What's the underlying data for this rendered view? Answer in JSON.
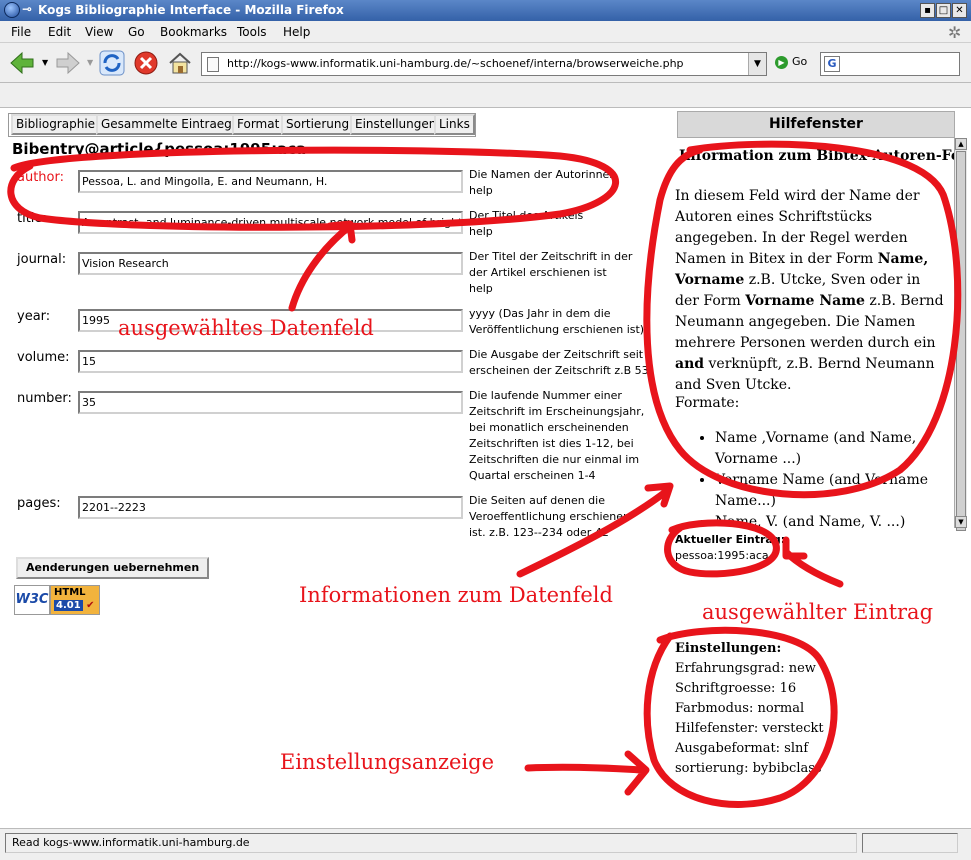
{
  "window": {
    "title": "Kogs Bibliographie Interface - Mozilla Firefox"
  },
  "menu": [
    "File",
    "Edit",
    "View",
    "Go",
    "Bookmarks",
    "Tools",
    "Help"
  ],
  "navbar": {
    "url": "http://kogs-www.informatik.uni-hamburg.de/~schoenef/interna/browserweiche.php",
    "go_label": "Go",
    "search_engine_letter": "G"
  },
  "tabs": [
    "Bibliographie",
    "Gesammelte Eintraege",
    "Format",
    "Sortierung",
    "Einstellungen",
    "Links"
  ],
  "entry_heading": "Bibentry@article{pessoa:1995:aca",
  "fields": [
    {
      "label": "author:",
      "value": "Pessoa, L. and Mingolla, E. and Neumann, H.",
      "help": "Die Namen der Autorinnen",
      "help2": "help"
    },
    {
      "label": "title:",
      "value": "A contrast- and luminance-driven multiscale network model of brightness",
      "help": "Der Titel des Artikels",
      "help2": "help"
    },
    {
      "label": "journal:",
      "value": "Vision Research",
      "help": "Der Titel der Zeitschrift in der der Artikel erschienen ist",
      "help2": "help"
    },
    {
      "label": "year:",
      "value": "1995",
      "help": "yyyy (Das Jahr in dem die Veröffentlichung erschienen ist)"
    },
    {
      "label": "volume:",
      "value": "15",
      "help": "Die Ausgabe der Zeitschrift seit erscheinen der Zeitschrift z.B 53"
    },
    {
      "label": "number:",
      "value": "35",
      "help": "Die laufende Nummer einer Zeitschrift im Erscheinungsjahr, bei monatlich erscheinenden Zeitschriften ist dies 1-12, bei Zeitschriften die nur einmal im Quartal erscheinen 1-4"
    },
    {
      "label": "pages:",
      "value": "2201--2223",
      "help": "Die Seiten auf denen die Veroeffentlichung erschienen ist. z.B. 123--234 oder 42"
    }
  ],
  "submit_label": "Aenderungen uebernehmen",
  "badge": {
    "w3c": "W3C",
    "html": "HTML",
    "version": "4.01"
  },
  "help_panel": {
    "header": "Hilfefenster",
    "title": "Information zum Bibtex-Autoren-Feld",
    "para1_a": "In diesem Feld wird der Name der Autoren eines Schriftstücks angegeben. In der Regel werden Namen in Bitex in der Form ",
    "para1_b": "Name, Vorname",
    "para1_c": " z.B. Utcke, Sven oder in der Form ",
    "para1_d": "Vorname Name",
    "para1_e": " z.B. Bernd Neumann angegeben. Die Namen mehrere Personen werden durch ein ",
    "para1_f": "and",
    "para1_g": " verknüpft, z.B. Bernd Neumann and Sven Utcke.",
    "formats_label": "Formate:",
    "formats": [
      "Name ,Vorname (and Name, Vorname ...)",
      "Vorname Name (and Vorname Name...)",
      "Name, V. (and Name, V. ...)"
    ]
  },
  "current_entry": {
    "label": "Aktueller Eintrag",
    "value": "pessoa:1995:aca"
  },
  "settings": {
    "label": "Einstellungen",
    "lines": [
      "Erfahrungsgrad: new",
      "Schriftgroesse: 16",
      "Farbmodus: normal",
      "Hilfefenster: versteckt",
      "Ausgabeformat: slnf",
      "sortierung: bybibclass"
    ]
  },
  "annotations": {
    "selected_field": "ausgewähltes Datenfeld",
    "field_info": "Informationen zum Datenfeld",
    "selected_entry": "ausgewählter Eintrag",
    "settings_display": "Einstellungsanzeige",
    "color": "#e8141b"
  },
  "status": "Read kogs-www.informatik.uni-hamburg.de"
}
